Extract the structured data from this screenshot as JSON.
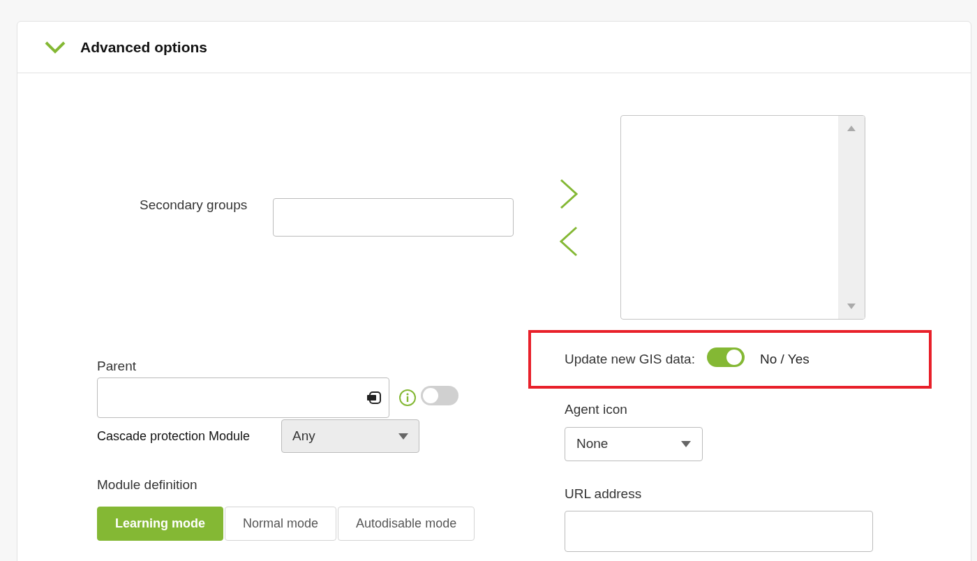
{
  "section": {
    "title": "Advanced options",
    "expanded": true
  },
  "secondary_groups": {
    "label": "Secondary groups"
  },
  "gis_update": {
    "label": "Update new GIS data:",
    "on": true,
    "caption": "No / Yes"
  },
  "parent": {
    "label": "Parent",
    "toggle_on": false
  },
  "cascade_protection": {
    "label": "Cascade protection Module",
    "value": "Any"
  },
  "module_definition": {
    "label": "Module definition",
    "modes": [
      {
        "label": "Learning mode",
        "selected": true
      },
      {
        "label": "Normal mode",
        "selected": false
      },
      {
        "label": "Autodisable mode",
        "selected": false
      }
    ]
  },
  "agent_icon": {
    "label": "Agent icon",
    "value": "None"
  },
  "url_address": {
    "label": "URL address"
  }
}
